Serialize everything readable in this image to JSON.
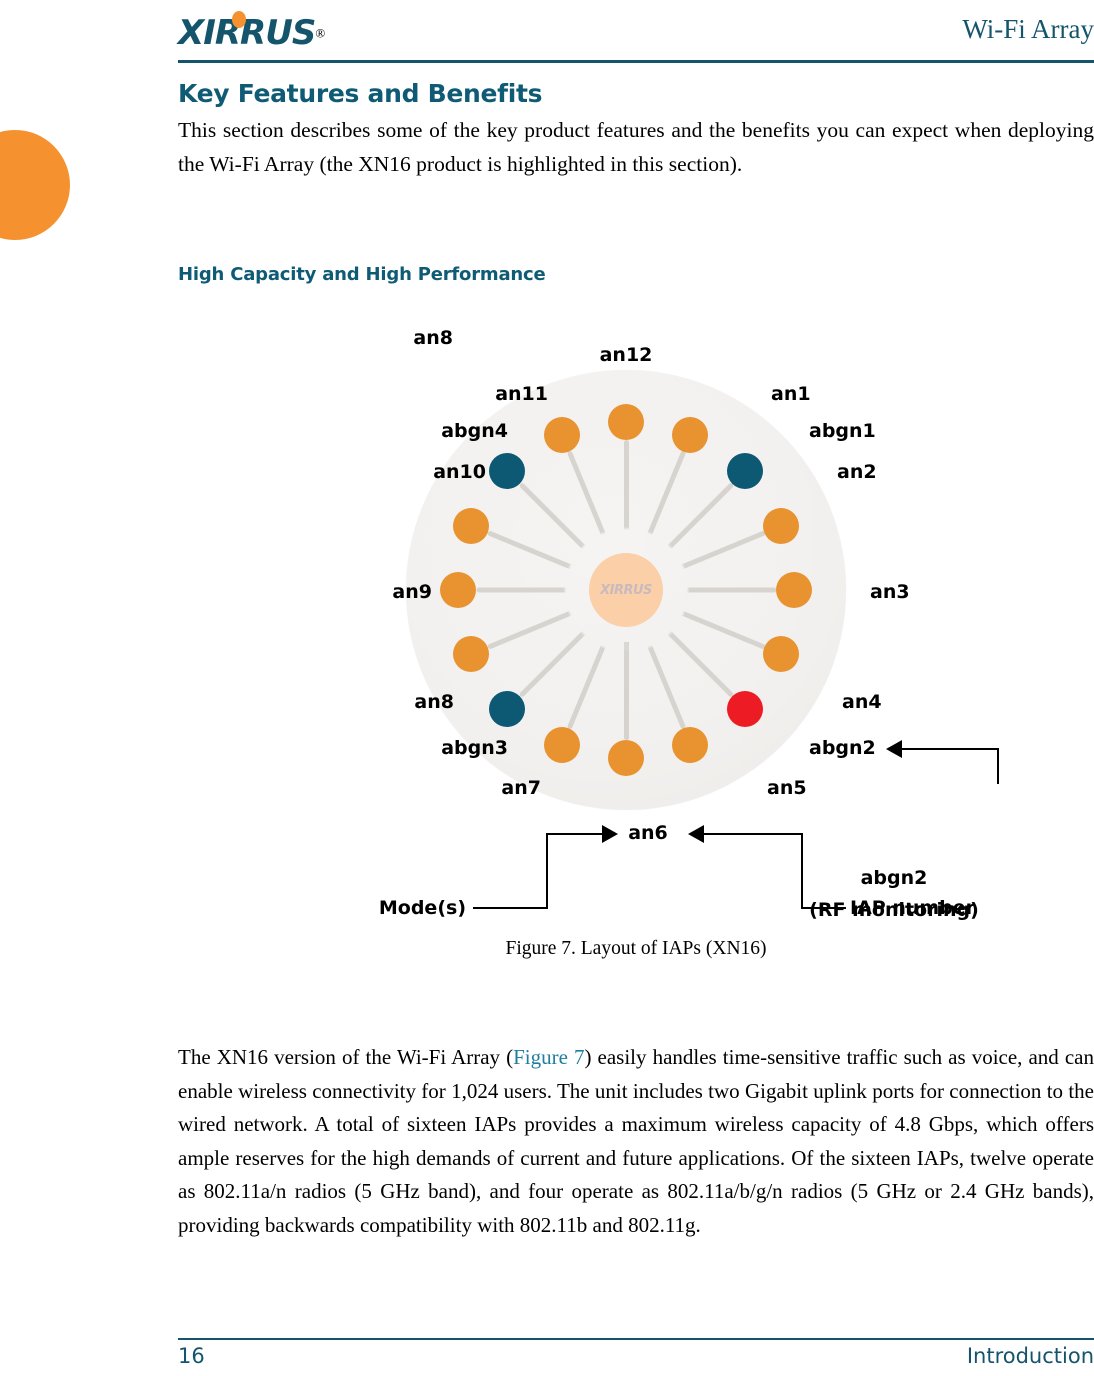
{
  "header": {
    "logo_text": "XIRRUS",
    "logo_mark": "registered-trademark",
    "title": "Wi-Fi Array"
  },
  "section": {
    "title": "Key Features and Benefits",
    "intro_paragraph": "This section describes some of the key product features and the benefits you can expect when deploying the Wi-Fi Array (the XN16 product is highlighted in this section).",
    "subtitle": "High Capacity and High Performance"
  },
  "figure": {
    "caption": "Figure 7. Layout of IAPs (XN16)",
    "center_logo_text": "XIRRUS",
    "colors": {
      "an_dot": "#e8932f",
      "abgn_dot": "#0d5973",
      "rf_monitor_dot": "#ed1c24",
      "disc": "#f3f1ef",
      "center_hub": "#fbcfa8"
    },
    "iaps": [
      {
        "label": "an12",
        "mode": "an",
        "angle": 0,
        "color_key": "an_dot"
      },
      {
        "label": "an1",
        "mode": "an",
        "angle": 22.5,
        "color_key": "an_dot"
      },
      {
        "label": "abgn1",
        "mode": "abgn",
        "angle": 45,
        "color_key": "abgn_dot"
      },
      {
        "label": "an2",
        "mode": "an",
        "angle": 67.5,
        "color_key": "an_dot"
      },
      {
        "label": "an3",
        "mode": "an",
        "angle": 90,
        "color_key": "an_dot"
      },
      {
        "label": "an4",
        "mode": "an",
        "angle": 112.5,
        "color_key": "an_dot"
      },
      {
        "label": "abgn2",
        "mode": "abgn",
        "angle": 135,
        "color_key": "rf_monitor_dot"
      },
      {
        "label": "an5",
        "mode": "an",
        "angle": 157.5,
        "color_key": "an_dot"
      },
      {
        "label": "an6",
        "mode": "an",
        "angle": 180,
        "color_key": "an_dot"
      },
      {
        "label": "an7",
        "mode": "an",
        "angle": 202.5,
        "color_key": "an_dot"
      },
      {
        "label": "abgn3",
        "mode": "abgn",
        "angle": 225,
        "color_key": "abgn_dot"
      },
      {
        "label": "an8",
        "mode": "an",
        "angle": 247.5,
        "color_key": "an_dot"
      },
      {
        "label": "an9",
        "mode": "an",
        "angle": 270,
        "color_key": "an_dot"
      },
      {
        "label": "an10",
        "mode": "an",
        "angle": 292.5,
        "color_key": "an_dot"
      },
      {
        "label": "abgn4",
        "mode": "abgn",
        "angle": 315,
        "color_key": "abgn_dot"
      },
      {
        "label": "an11",
        "mode": "an",
        "angle": 337.5,
        "color_key": "an_dot"
      }
    ],
    "labels": {
      "an12": "an12",
      "an11": "an11",
      "abgn4": "abgn4",
      "an10": "an10",
      "an9": "an9",
      "an8": "an8",
      "abgn3": "abgn3",
      "an7": "an7",
      "an6": "an6",
      "an5": "an5",
      "abgn2": "abgn2",
      "an4": "an4",
      "an3": "an3",
      "an2": "an2",
      "abgn1": "abgn1",
      "an1": "an1"
    },
    "callouts": {
      "rf_monitoring_line1": "abgn2",
      "rf_monitoring_line2": "(RF monitoring)",
      "iap_number": "IAP number",
      "modes": "Mode(s)"
    }
  },
  "body": {
    "paragraph_2_part1": "The XN16 version of the Wi-Fi Array (",
    "paragraph_2_link": "Figure 7",
    "paragraph_2_part2": ") easily handles time-sensitive traffic such as voice, and can enable wireless connectivity for 1,024 users. The unit includes two Gigabit uplink ports for connection to the wired network. A total of sixteen IAPs provides a maximum wireless capacity of 4.8 Gbps, which offers ample reserves for the high demands of current and future applications. Of the sixteen IAPs, twelve operate as 802.11a/n radios (5 GHz band), and four operate as 802.11a/b/g/n radios (5 GHz or 2.4 GHz bands), providing backwards compatibility with 802.11b and 802.11g."
  },
  "footer": {
    "page_number": "16",
    "chapter": "Introduction"
  }
}
